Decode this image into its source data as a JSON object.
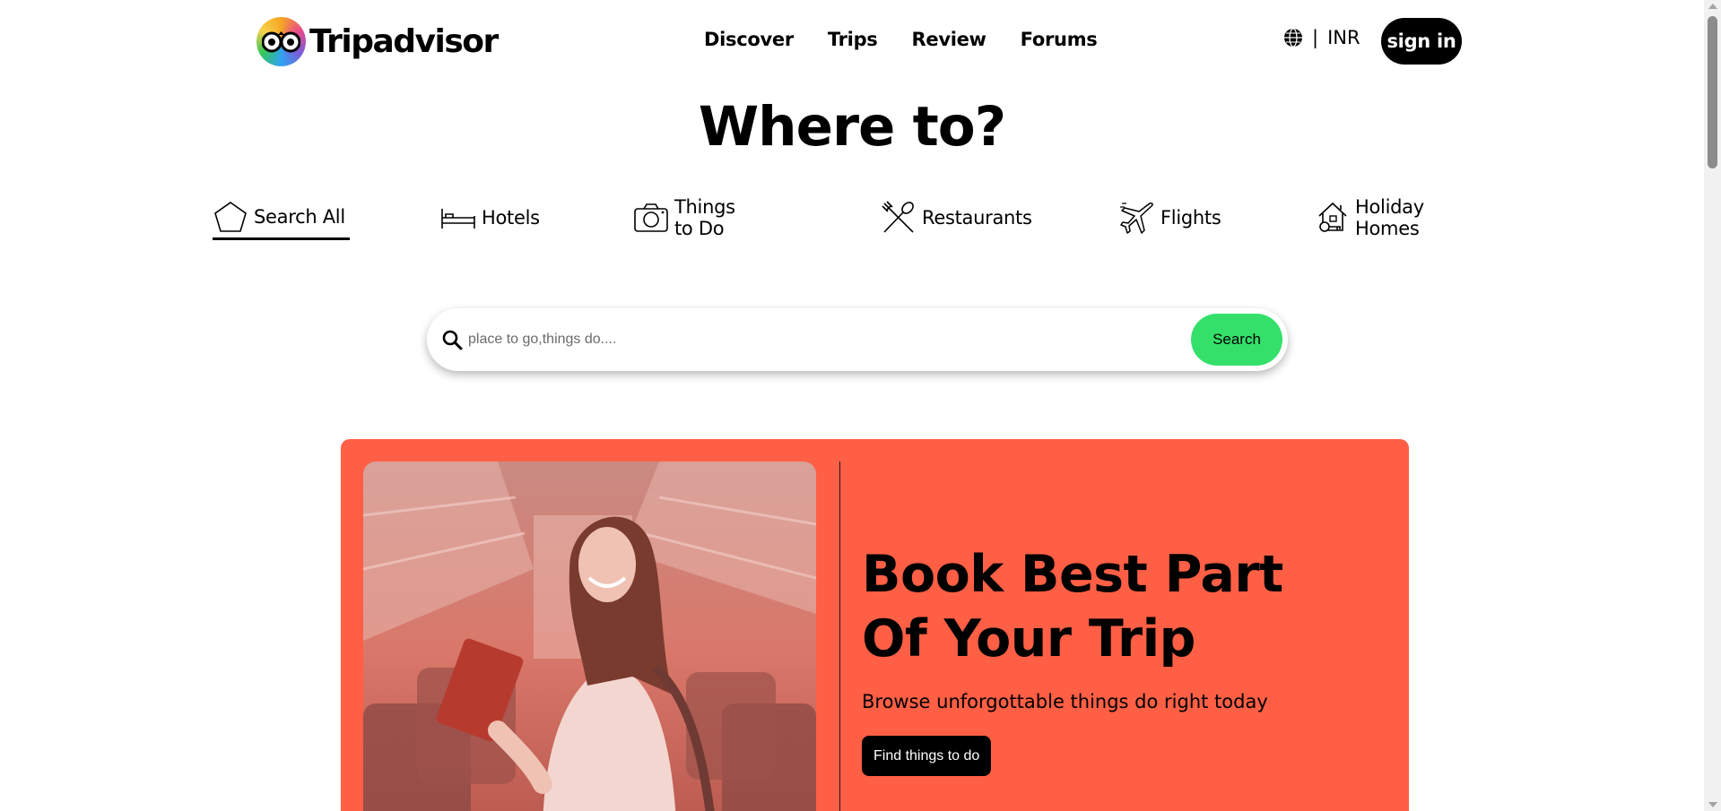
{
  "header": {
    "logo_text": "Tripadvisor",
    "nav": [
      "Discover",
      "Trips",
      "Review",
      "Forums"
    ],
    "currency": "INR",
    "separator": "|",
    "sign_in_label": "sign in"
  },
  "hero": {
    "title": "Where to?"
  },
  "tabs": [
    {
      "label": "Search All",
      "icon": "pentagon-icon",
      "active": true
    },
    {
      "label": "Hotels",
      "icon": "bed-icon",
      "active": false
    },
    {
      "label": "Things to Do",
      "icon": "camera-icon",
      "active": false
    },
    {
      "label": "Restaurants",
      "icon": "fork-spoon-icon",
      "active": false
    },
    {
      "label": "Flights",
      "icon": "plane-icon",
      "active": false
    },
    {
      "label": "Holiday Homes",
      "icon": "house-key-icon",
      "active": false
    }
  ],
  "search": {
    "placeholder": "place to go,things do....",
    "value": "",
    "button_label": "Search"
  },
  "promo": {
    "title": "Book Best Part Of Your Trip",
    "subtitle": "Browse unforgottable things do right today",
    "button_label": "Find things to do"
  },
  "colors": {
    "accent_green": "#34e06a",
    "promo_bg": "#ff5f45",
    "black": "#000000"
  }
}
